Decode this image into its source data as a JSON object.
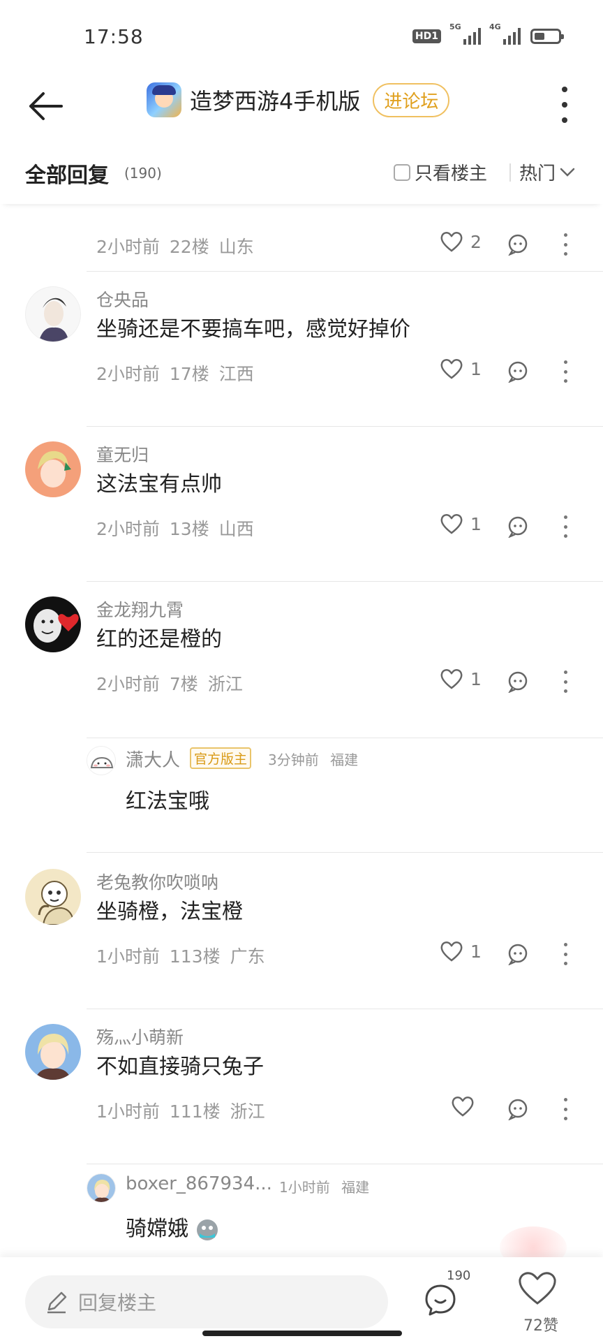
{
  "status_bar": {
    "time": "17:58",
    "hd_label": "HD1",
    "net1": "5G",
    "net2": "4G"
  },
  "nav": {
    "title": "造梦西游4手机版",
    "forum_button": "进论坛"
  },
  "reply_header": {
    "title": "全部回复",
    "count": "(190)",
    "only_op": "只看楼主",
    "sort": "热门"
  },
  "top_partial": {
    "time": "2小时前",
    "floor": "22楼",
    "location": "山东",
    "likes": "2"
  },
  "comments": [
    {
      "username": "仓央品",
      "text": "坐骑还是不要搞车吧，感觉好掉价",
      "time": "2小时前",
      "floor": "17楼",
      "location": "江西",
      "likes": "1"
    },
    {
      "username": "童无归",
      "text": "这法宝有点帅",
      "time": "2小时前",
      "floor": "13楼",
      "location": "山西",
      "likes": "1"
    },
    {
      "username": "金龙翔九霄",
      "text": "红的还是橙的",
      "time": "2小时前",
      "floor": "7楼",
      "location": "浙江",
      "likes": "1"
    },
    {
      "username": "老兔教你吹唢呐",
      "text": "坐骑橙，法宝橙",
      "time": "1小时前",
      "floor": "113楼",
      "location": "广东",
      "likes": "1"
    },
    {
      "username": "殇灬小萌新",
      "text": "不如直接骑只兔子",
      "time": "1小时前",
      "floor": "111楼",
      "location": "浙江",
      "likes": ""
    }
  ],
  "sub_replies": [
    {
      "username": "潇大人",
      "badge": "官方版主",
      "time": "3分钟前",
      "location": "福建",
      "text": "红法宝哦"
    },
    {
      "username": "boxer_867934...",
      "badge": "",
      "time": "1小时前",
      "location": "福建",
      "text": "骑嫦娥"
    }
  ],
  "bottom_bar": {
    "placeholder": "回复楼主",
    "comment_count": "190",
    "like_count": "72赞"
  }
}
